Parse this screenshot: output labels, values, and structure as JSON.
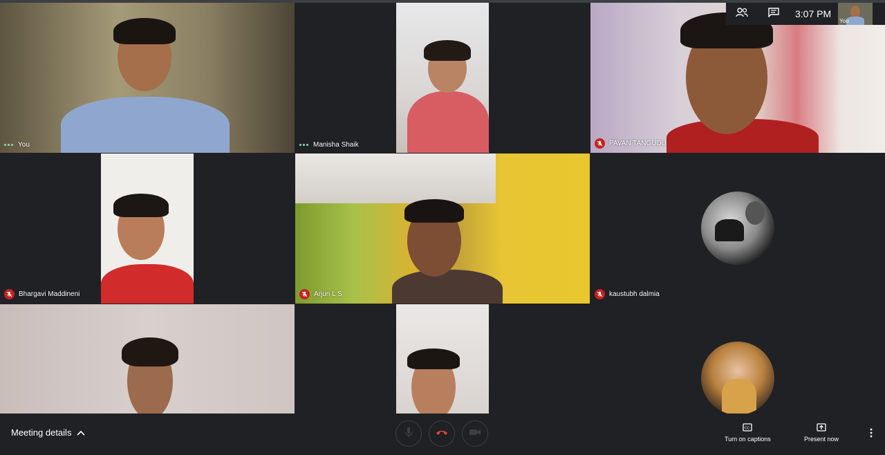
{
  "tiles": [
    {
      "name": "You",
      "status": "talking"
    },
    {
      "name": "Manisha Shaik",
      "status": "talking"
    },
    {
      "name": "PAVAN TANGUDU",
      "status": "muted"
    },
    {
      "name": "Bhargavi Maddineni",
      "status": "muted"
    },
    {
      "name": "Arjun L S",
      "status": "muted"
    },
    {
      "name": "kaustubh dalmia",
      "status": "muted"
    },
    {
      "name": "",
      "status": "none"
    },
    {
      "name": "",
      "status": "none"
    },
    {
      "name": "",
      "status": "none"
    }
  ],
  "top_bar": {
    "icons": [
      "people-icon",
      "chat-icon"
    ],
    "time": "3:07 PM",
    "self_label": "You"
  },
  "bottom_bar": {
    "meeting_details": "Meeting details",
    "captions": "Turn on captions",
    "present": "Present now"
  },
  "colors": {
    "background": "#202124",
    "muted_red": "#c5221f",
    "hangup_red": "#ea4335",
    "talking_green": "#8ae2a9"
  }
}
